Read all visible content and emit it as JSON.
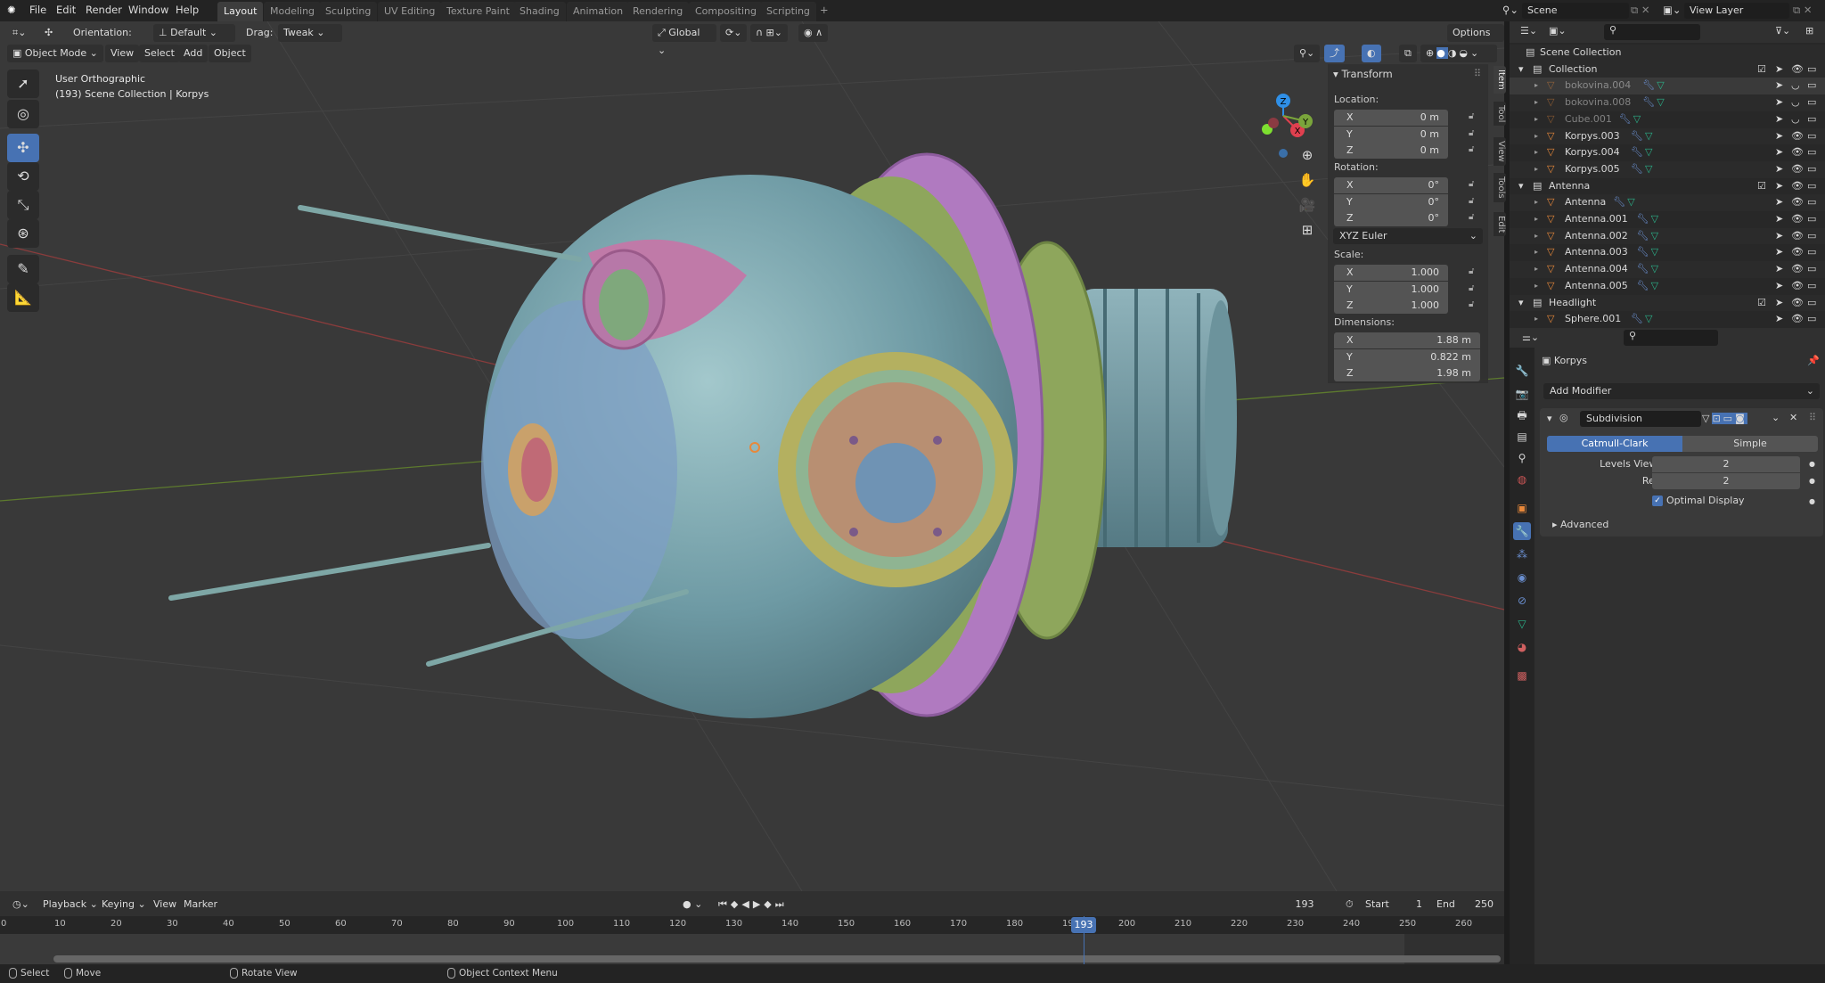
{
  "topbar": {
    "menus": [
      "File",
      "Edit",
      "Render",
      "Window",
      "Help"
    ],
    "workspaces": [
      "Layout",
      "Modeling",
      "Sculpting",
      "UV Editing",
      "Texture Paint",
      "Shading",
      "Animation",
      "Rendering",
      "Compositing",
      "Scripting"
    ],
    "active_workspace": "Layout",
    "add_workspace": "+",
    "scene": "Scene",
    "view_layer": "View Layer"
  },
  "tool_header": {
    "orientation_label": "Orientation:",
    "orientation": "Default",
    "drag_label": "Drag:",
    "drag": "Tweak",
    "transform_orientation": "Global",
    "options": "Options"
  },
  "viewport_header": {
    "mode": "Object Mode",
    "menus": [
      "View",
      "Select",
      "Add",
      "Object"
    ]
  },
  "overlay": {
    "view_name": "User Orthographic",
    "context": "(193) Scene Collection | Korpys"
  },
  "gizmo": {
    "x": "X",
    "y": "Y",
    "z": "Z"
  },
  "npanel": {
    "tabs": [
      "Item",
      "Tool",
      "View",
      "Tools",
      "Edit"
    ],
    "title": "Transform",
    "location_label": "Location:",
    "location": {
      "x": "0 m",
      "y": "0 m",
      "z": "0 m"
    },
    "rotation_label": "Rotation:",
    "rotation": {
      "x": "0°",
      "y": "0°",
      "z": "0°"
    },
    "rotation_mode": "XYZ Euler",
    "scale_label": "Scale:",
    "scale": {
      "x": "1.000",
      "y": "1.000",
      "z": "1.000"
    },
    "dimensions_label": "Dimensions:",
    "dimensions": {
      "x": "1.88 m",
      "y": "0.822 m",
      "z": "1.98 m"
    },
    "axes": [
      "X",
      "Y",
      "Z"
    ]
  },
  "outliner": {
    "root": "Scene Collection",
    "collections": [
      {
        "name": "Collection",
        "children": [
          {
            "name": "bokovina.004",
            "dimmed": true,
            "hidden": true
          },
          {
            "name": "bokovina.008",
            "dimmed": true,
            "hidden": true
          },
          {
            "name": "Cube.001",
            "dimmed": true,
            "hidden": true
          },
          {
            "name": "Korpys.003"
          },
          {
            "name": "Korpys.004"
          },
          {
            "name": "Korpys.005"
          }
        ]
      },
      {
        "name": "Antenna",
        "children": [
          {
            "name": "Antenna"
          },
          {
            "name": "Antenna.001"
          },
          {
            "name": "Antenna.002"
          },
          {
            "name": "Antenna.003"
          },
          {
            "name": "Antenna.004"
          },
          {
            "name": "Antenna.005"
          }
        ]
      },
      {
        "name": "Headlight",
        "children": [
          {
            "name": "Sphere.001"
          }
        ]
      }
    ]
  },
  "properties": {
    "object": "Korpys",
    "add_modifier": "Add Modifier",
    "modifier": {
      "name": "Subdivision",
      "types": [
        "Catmull-Clark",
        "Simple"
      ],
      "active_type": "Catmull-Clark",
      "levels_viewport_label": "Levels Viewport",
      "levels_viewport": "2",
      "render_label": "Render",
      "render": "2",
      "optimal_display_label": "Optimal Display",
      "optimal_display": true,
      "advanced": "Advanced"
    }
  },
  "timeline": {
    "menus": [
      "Playback",
      "Keying",
      "View",
      "Marker"
    ],
    "current_frame": "193",
    "start_label": "Start",
    "start": "1",
    "end_label": "End",
    "end": "250",
    "ticks": [
      "0",
      "10",
      "20",
      "30",
      "40",
      "50",
      "60",
      "70",
      "80",
      "90",
      "100",
      "110",
      "120",
      "130",
      "140",
      "150",
      "160",
      "170",
      "180",
      "190",
      "200",
      "210",
      "220",
      "230",
      "240",
      "250",
      "260"
    ]
  },
  "statusbar": {
    "items": [
      "Select",
      "Move",
      "Rotate View",
      "Object Context Menu"
    ]
  },
  "colors": {
    "accent": "#4772b3",
    "object_orange": "#e8883a",
    "mesh_green": "#2bb38a",
    "modifier_blue": "#6a8fd0"
  }
}
